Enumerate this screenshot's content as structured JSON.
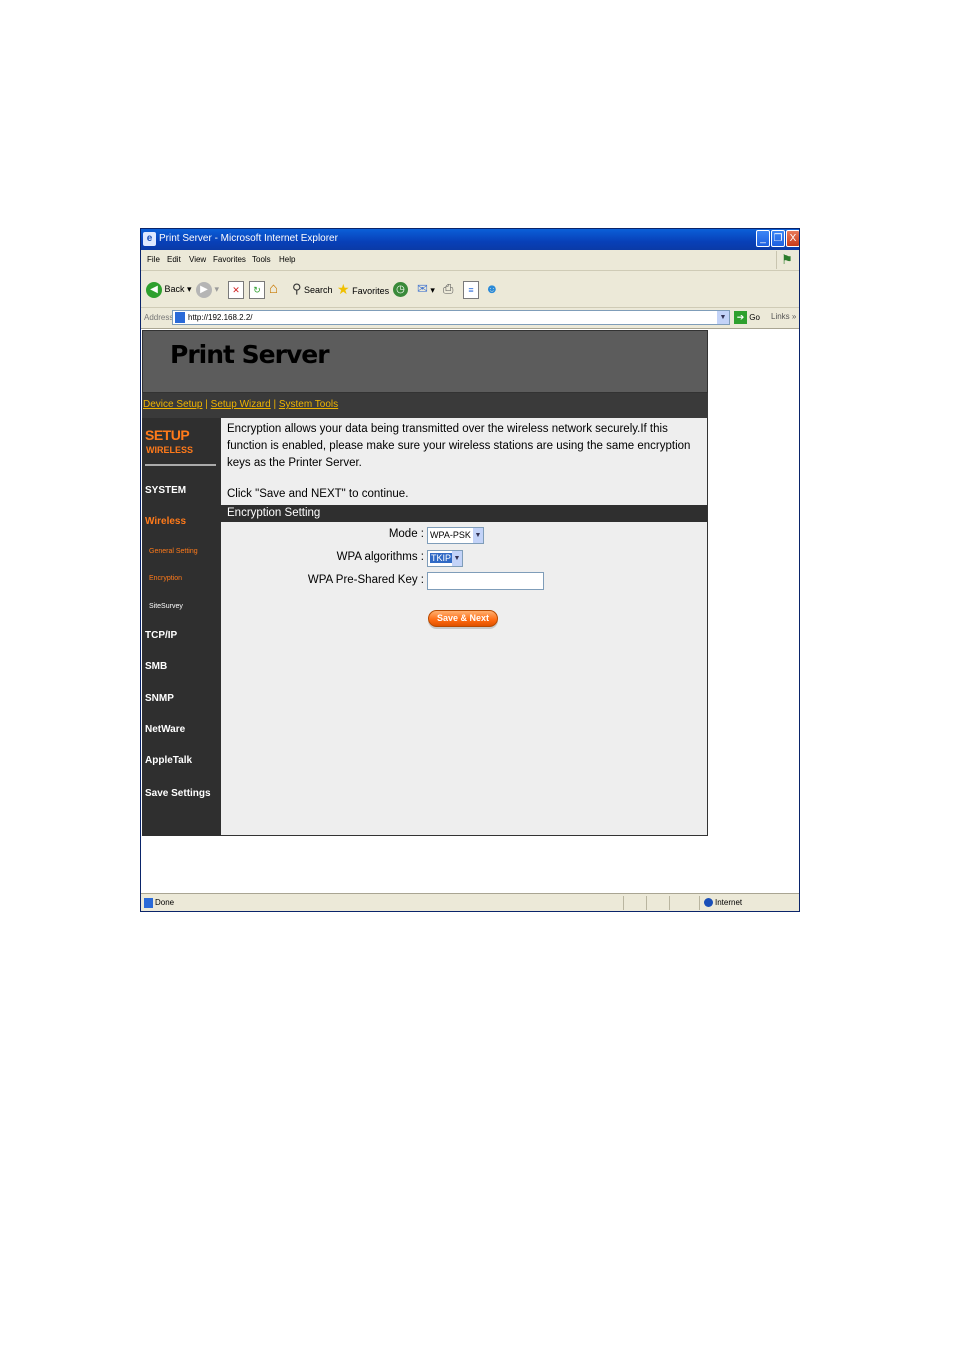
{
  "window": {
    "title": "Print Server - Microsoft Internet Explorer",
    "min_label": "_",
    "max_label": "❐",
    "close_label": "X"
  },
  "menu": [
    "File",
    "Edit",
    "View",
    "Favorites",
    "Tools",
    "Help"
  ],
  "toolbar": {
    "back_label": "Back",
    "search_label": "Search",
    "favorites_label": "Favorites"
  },
  "address": {
    "label": "Address",
    "url": "http://192.168.2.2/",
    "go_label": "Go",
    "links_label": "Links"
  },
  "page": {
    "banner_title": "Print Server",
    "nav": {
      "device_setup": "Device Setup",
      "setup_wizard": "Setup Wizard",
      "system_tools": "System Tools",
      "separator": "|"
    },
    "sidebar": {
      "setup": "SETUP",
      "section": "WIRELESS",
      "system": "SYSTEM",
      "wireless": "Wireless",
      "general_setting": "General Setting",
      "encryption": "Encryption",
      "site_survey": "SiteSurvey",
      "tcpip": "TCP/IP",
      "smb": "SMB",
      "snmp": "SNMP",
      "netware": "NetWare",
      "appletalk": "AppleTalk",
      "save_settings": "Save Settings"
    },
    "description": "Encryption allows your data being transmitted over the wireless network securely.If this function is enabled, please make sure your wireless stations are using the same encryption keys as the Printer Server.",
    "instruction": "Click \"Save and NEXT\" to continue.",
    "section_title": "Encryption Setting",
    "form": {
      "mode_label": "Mode :",
      "mode_value": "WPA-PSK",
      "algo_label": "WPA algorithms :",
      "algo_value": "TKIP",
      "key_label": "WPA Pre-Shared Key :",
      "key_value": ""
    },
    "save_button": "Save & Next"
  },
  "status": {
    "left": "Done",
    "zone": "Internet"
  },
  "colors": {
    "nav_link": "#f0b400",
    "sidebar_accent": "#ff7a1a",
    "sidebar_bg": "#2f2f2f",
    "banner_bg": "#5c5c5c"
  }
}
